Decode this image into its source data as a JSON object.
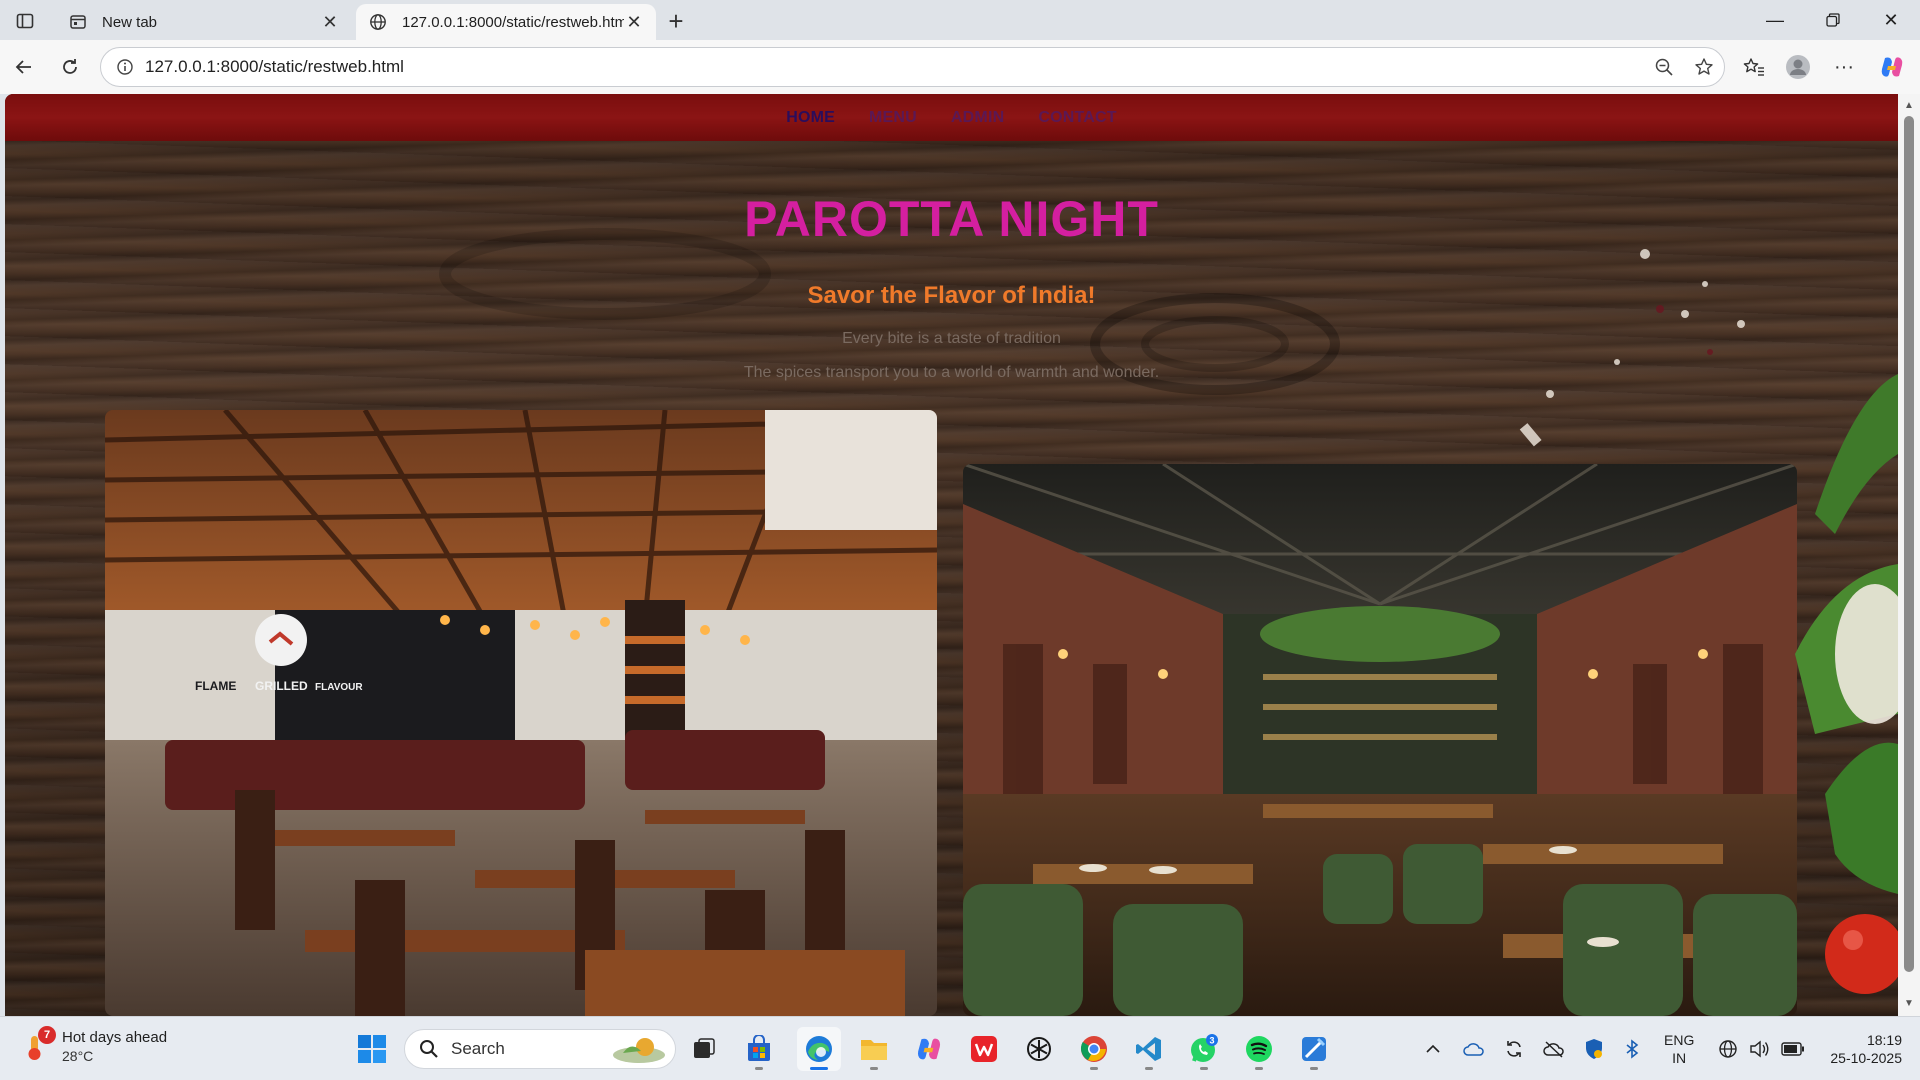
{
  "browser": {
    "tabs": [
      {
        "title": "New tab",
        "active": false
      },
      {
        "title": "127.0.0.1:8000/static/restweb.html",
        "active": true
      }
    ],
    "url": "127.0.0.1:8000/static/restweb.html"
  },
  "page": {
    "nav": [
      "HOME",
      "MENU",
      "ADMIN",
      "CONTACT"
    ],
    "title": "PAROTTA NIGHT",
    "tagline": "Savor the Flavor of India!",
    "line1": "Every bite is a taste of tradition",
    "line2": "The spices transport you to a world of warmth and wonder.",
    "photos": [
      {
        "sign_text": [
          "FLAME",
          "GRILLED",
          "FLAVOUR"
        ]
      },
      {
        "sign_text": []
      }
    ],
    "colors": {
      "title": "#d41fa0",
      "tagline": "#f07a2a",
      "navbar": "#8b1414",
      "nav_text": "#3b0f6a"
    }
  },
  "taskbar": {
    "weather": {
      "headline": "Hot days ahead",
      "temp": "28°C",
      "badge": "7"
    },
    "search_placeholder": "Search",
    "apps": [
      "windows-start",
      "search",
      "task-view",
      "microsoft-store",
      "edge",
      "file-explorer",
      "copilot",
      "wps-office",
      "chatgpt",
      "chrome",
      "vscode",
      "whatsapp",
      "spotify",
      "photos-editor"
    ],
    "whatsapp_badge": "3",
    "language": [
      "ENG",
      "IN"
    ],
    "time": "18:19",
    "date": "25-10-2025"
  }
}
